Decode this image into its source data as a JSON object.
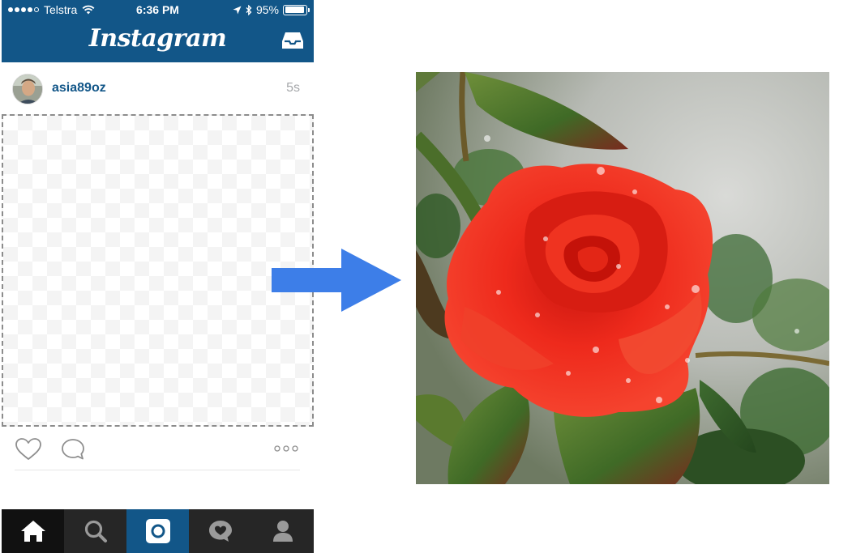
{
  "statusbar": {
    "carrier": "Telstra",
    "time": "6:36 PM",
    "battery": "95%",
    "battery_level": 0.95
  },
  "navbar": {
    "title": "Instagram",
    "inbox_icon": "inbox-tray-icon"
  },
  "post": {
    "username": "asia89oz",
    "timestamp": "5s",
    "image_state": "empty-placeholder"
  },
  "actions": {
    "like_icon": "heart-outline-icon",
    "comment_icon": "speech-bubble-icon",
    "more_icon": "ellipsis-icon"
  },
  "tabbar": {
    "tabs": [
      {
        "name": "home",
        "icon": "home-icon",
        "active": true
      },
      {
        "name": "search",
        "icon": "search-icon",
        "active": false
      },
      {
        "name": "camera",
        "icon": "camera-icon",
        "active": false
      },
      {
        "name": "activity",
        "icon": "heart-bubble-icon",
        "active": false
      },
      {
        "name": "profile",
        "icon": "person-icon",
        "active": false
      }
    ]
  },
  "colors": {
    "brand_blue": "#125688",
    "tabbar_dark": "#262626",
    "username_blue": "#125688",
    "arrow_blue": "#3d7ee8",
    "rose_red": "#e8251a"
  },
  "transition": {
    "arrow_icon": "arrow-right-icon"
  },
  "result_image": {
    "subject": "red rose"
  }
}
